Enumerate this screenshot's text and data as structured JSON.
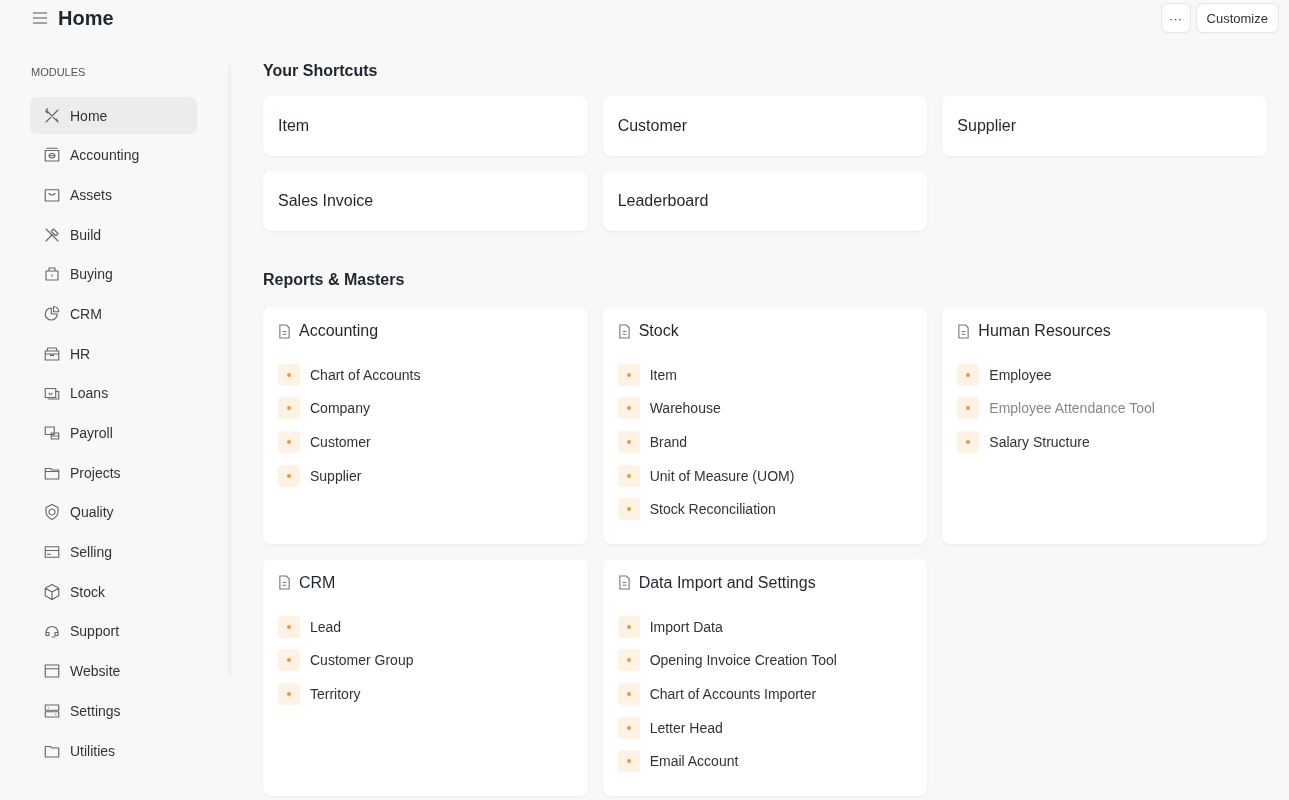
{
  "header": {
    "title": "Home",
    "buttons": [
      "···",
      "Customize"
    ]
  },
  "sidebar": {
    "heading": "MODULES",
    "items": [
      {
        "label": "Home",
        "selected": true
      },
      {
        "label": "Accounting",
        "selected": false
      },
      {
        "label": "Assets",
        "selected": false
      },
      {
        "label": "Build",
        "selected": false
      },
      {
        "label": "Buying",
        "selected": false
      },
      {
        "label": "CRM",
        "selected": false
      },
      {
        "label": "HR",
        "selected": false
      },
      {
        "label": "Loans",
        "selected": false
      },
      {
        "label": "Payroll",
        "selected": false
      },
      {
        "label": "Projects",
        "selected": false
      },
      {
        "label": "Quality",
        "selected": false
      },
      {
        "label": "Selling",
        "selected": false
      },
      {
        "label": "Stock",
        "selected": false
      },
      {
        "label": "Support",
        "selected": false
      },
      {
        "label": "Website",
        "selected": false
      },
      {
        "label": "Settings",
        "selected": false
      },
      {
        "label": "Utilities",
        "selected": false
      }
    ]
  },
  "shortcuts": {
    "title": "Your Shortcuts",
    "items": [
      "Item",
      "Customer",
      "Supplier",
      "Sales Invoice",
      "Leaderboard"
    ]
  },
  "reports": {
    "title": "Reports & Masters",
    "cards": [
      {
        "title": "Accounting",
        "links": [
          {
            "label": "Chart of Accounts",
            "disabled": false
          },
          {
            "label": "Company",
            "disabled": false
          },
          {
            "label": "Customer",
            "disabled": false
          },
          {
            "label": "Supplier",
            "disabled": false
          }
        ]
      },
      {
        "title": "Stock",
        "links": [
          {
            "label": "Item",
            "disabled": false
          },
          {
            "label": "Warehouse",
            "disabled": false
          },
          {
            "label": "Brand",
            "disabled": false
          },
          {
            "label": "Unit of Measure (UOM)",
            "disabled": false
          },
          {
            "label": "Stock Reconciliation",
            "disabled": false
          }
        ]
      },
      {
        "title": "Human Resources",
        "links": [
          {
            "label": "Employee",
            "disabled": false
          },
          {
            "label": "Employee Attendance Tool",
            "disabled": true
          },
          {
            "label": "Salary Structure",
            "disabled": false
          }
        ]
      },
      {
        "title": "CRM",
        "links": [
          {
            "label": "Lead",
            "disabled": false
          },
          {
            "label": "Customer Group",
            "disabled": false
          },
          {
            "label": "Territory",
            "disabled": false
          }
        ]
      },
      {
        "title": "Data Import and Settings",
        "links": [
          {
            "label": "Import Data",
            "disabled": false
          },
          {
            "label": "Opening Invoice Creation Tool",
            "disabled": false
          },
          {
            "label": "Chart of Accounts Importer",
            "disabled": false
          },
          {
            "label": "Letter Head",
            "disabled": false
          },
          {
            "label": "Email Account",
            "disabled": false
          }
        ]
      }
    ]
  }
}
